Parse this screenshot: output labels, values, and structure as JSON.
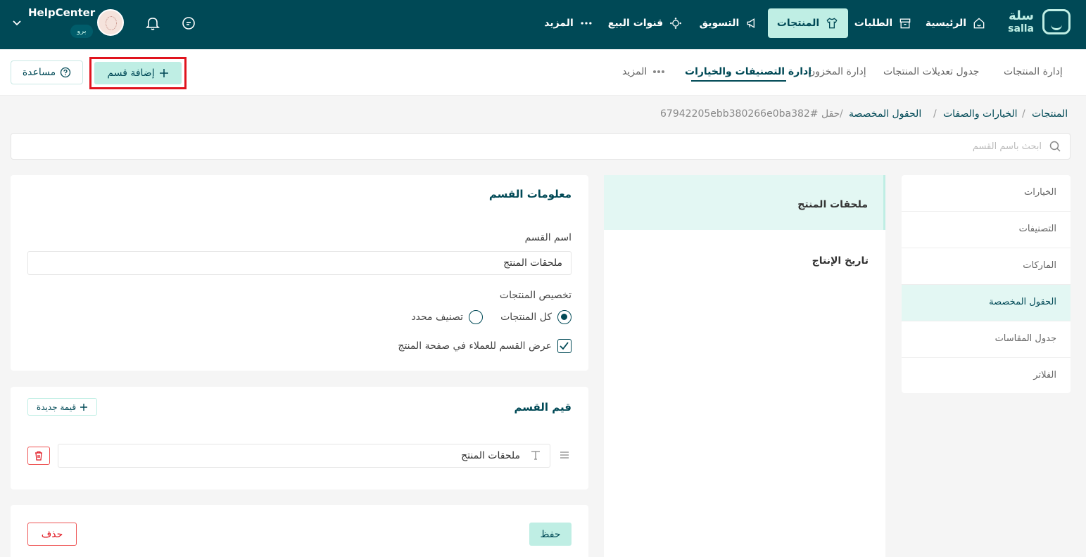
{
  "topbar": {
    "logo_ar": "سلة",
    "logo_en": "salla",
    "nav": [
      {
        "label": "الرئيسية",
        "icon": "home-icon"
      },
      {
        "label": "الطلبات",
        "icon": "archive-icon"
      },
      {
        "label": "المنتجات",
        "icon": "tshirt-icon"
      },
      {
        "label": "التسويق",
        "icon": "megaphone-icon"
      },
      {
        "label": "قنوات البيع",
        "icon": "channels-icon"
      },
      {
        "label": "المزيد",
        "icon": "more-dots-icon"
      }
    ],
    "user": {
      "name": "HelpCenter",
      "plan": "برو"
    }
  },
  "subnav": {
    "tabs": [
      {
        "label": "إدارة المنتجات"
      },
      {
        "label": "جدول تعديلات المنتجات"
      },
      {
        "label": "إدارة المخزون"
      },
      {
        "label": "إدارة التصنيفات والخيارات"
      },
      {
        "label": "المزيد"
      }
    ],
    "add_section_label": "إضافة قسم",
    "help_label": "مساعدة"
  },
  "breadcrumb": {
    "items": [
      "المنتجات",
      "الخيارات والصفات",
      "الحقول المخصصة",
      "حقل #67942205ebb380266e0ba382"
    ],
    "separator": "/"
  },
  "search": {
    "placeholder": "ابحث باسم القسم"
  },
  "categories": [
    "الخيارات",
    "التصنيفات",
    "الماركات",
    "الحقول المخصصة",
    "جدول المقاسات",
    "الفلاتر"
  ],
  "sections": [
    "ملحقات المنتج",
    "تاريخ الإنتاج"
  ],
  "section_info": {
    "title": "معلومات القسم",
    "name_label": "اسم القسم",
    "name_value": "ملحقات المنتج",
    "assign_label": "تخصيص المنتجات",
    "option_all": "كل المنتجات",
    "option_category": "تصنيف محدد",
    "show_label": "عرض القسم للعملاء في صفحة المنتج"
  },
  "section_values": {
    "title": "قيم القسم",
    "new_value_label": "قيمة جديدة",
    "values": [
      "ملحقات المنتج"
    ]
  },
  "actions": {
    "save_label": "حفظ",
    "delete_label": "حذف"
  }
}
